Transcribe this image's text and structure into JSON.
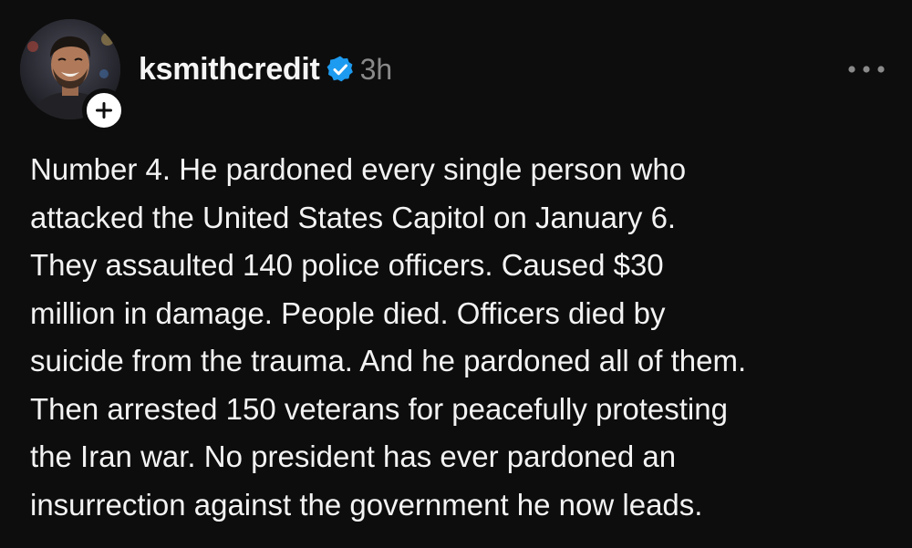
{
  "post": {
    "username": "ksmithcredit",
    "timestamp": "3h",
    "verified": true,
    "accent_color": "#1d9bf0",
    "body_lines": [
      "Number 4. He pardoned every single person who",
      "attacked the United States Capitol on January 6.",
      "They assaulted 140 police officers. Caused $30",
      "million in damage. People died. Officers died by",
      "suicide from the trauma. And he pardoned all of them.",
      "Then arrested 150 veterans for peacefully protesting",
      "the Iran war. No president has ever pardoned an",
      "insurrection against the government he now leads."
    ]
  },
  "icons": {
    "avatar": "avatar",
    "follow": "plus-icon",
    "verified": "verified-badge-icon",
    "more": "more-horizontal-icon"
  }
}
